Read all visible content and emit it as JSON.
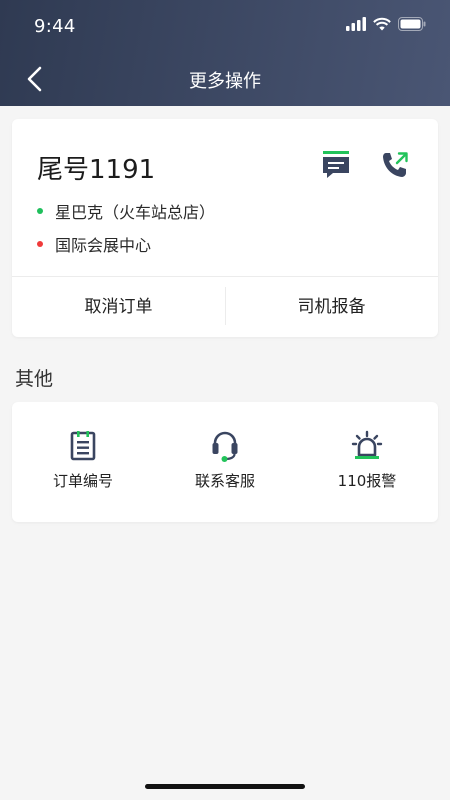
{
  "status_bar": {
    "time": "9:44"
  },
  "nav": {
    "title": "更多操作"
  },
  "order": {
    "tail_number": "尾号1191",
    "start": "星巴克（火车站总店）",
    "end": "国际会展中心",
    "cancel_label": "取消订单",
    "report_label": "司机报备"
  },
  "other": {
    "section_title": "其他",
    "tools": [
      {
        "label": "订单编号",
        "icon": "clipboard-icon"
      },
      {
        "label": "联系客服",
        "icon": "headset-icon"
      },
      {
        "label": "110报警",
        "icon": "alarm-siren-icon"
      }
    ]
  },
  "colors": {
    "header_start": "#2f3a52",
    "header_end": "#4a5674",
    "accent_green": "#22c35a",
    "dot_start": "#1fbf5c",
    "dot_end": "#f03a3a",
    "icon_dark": "#3a4560"
  }
}
